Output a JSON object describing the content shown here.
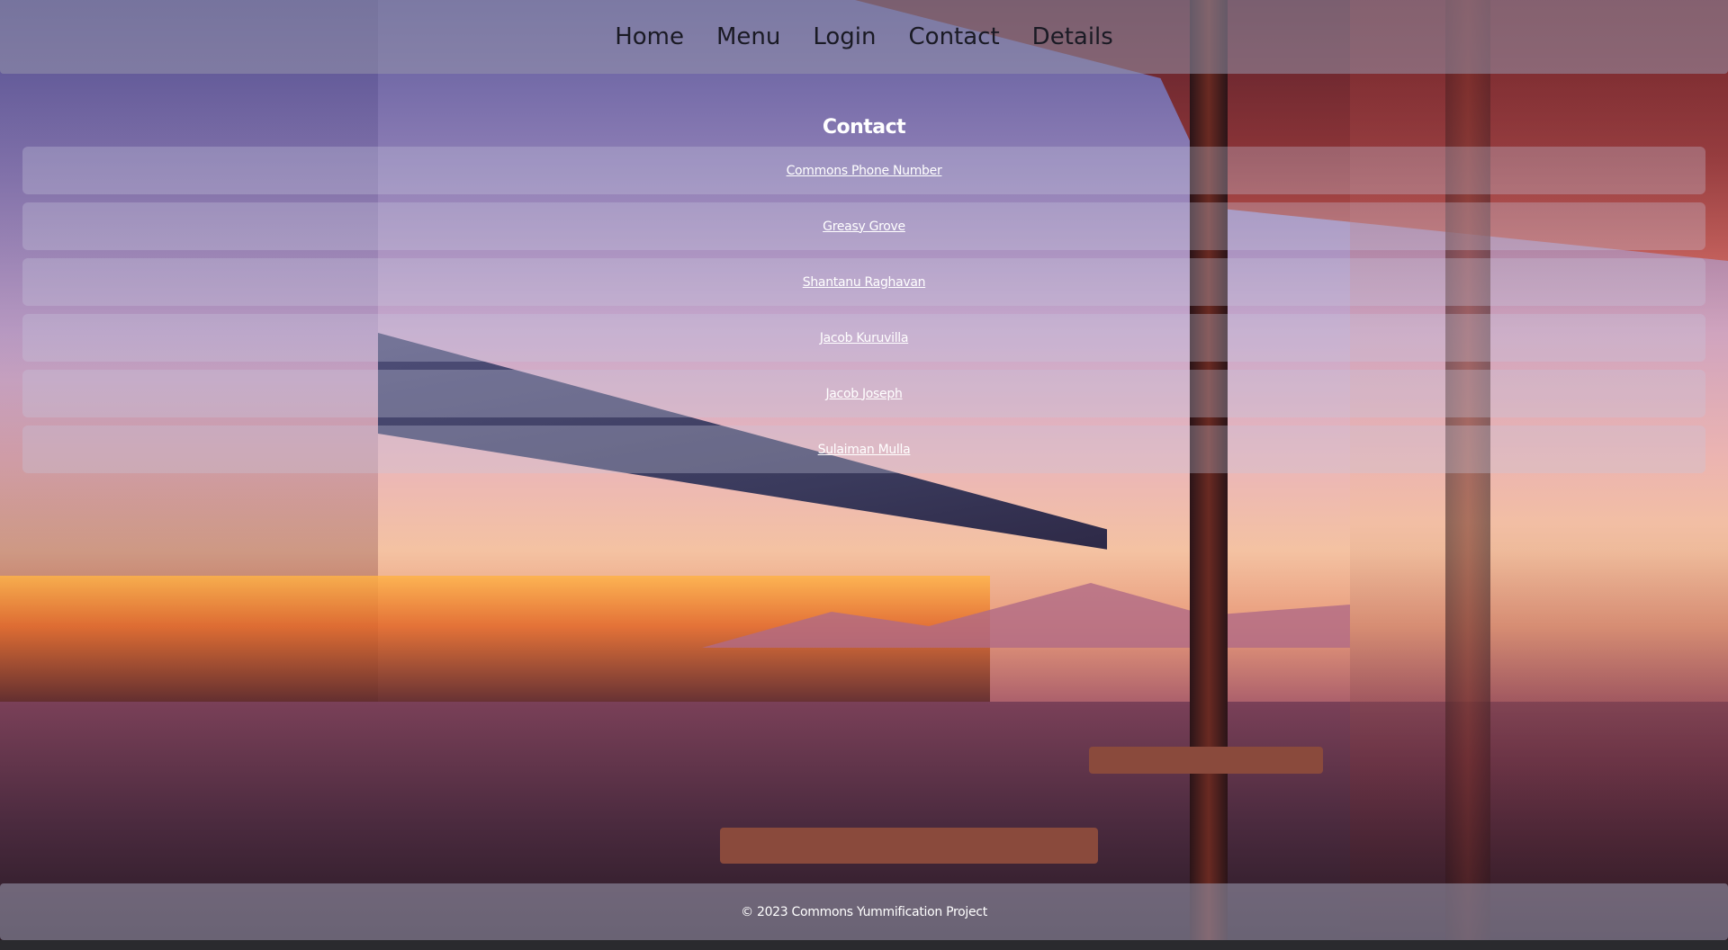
{
  "nav": {
    "items": [
      {
        "label": "Home"
      },
      {
        "label": "Menu"
      },
      {
        "label": "Login"
      },
      {
        "label": "Contact"
      },
      {
        "label": "Details"
      }
    ]
  },
  "main": {
    "heading": "Contact",
    "contacts": [
      {
        "label": "Commons Phone Number"
      },
      {
        "label": "Greasy Grove"
      },
      {
        "label": "Shantanu Raghavan"
      },
      {
        "label": "Jacob Kuruvilla"
      },
      {
        "label": "Jacob Joseph"
      },
      {
        "label": "Sulaiman Mulla"
      }
    ]
  },
  "footer": {
    "text": "© 2023 Commons Yummification Project"
  },
  "colors": {
    "nav_text": "#1a1a24",
    "link_text": "#ffffff",
    "panel_bg": "rgba(150,148,170,0.55)"
  }
}
